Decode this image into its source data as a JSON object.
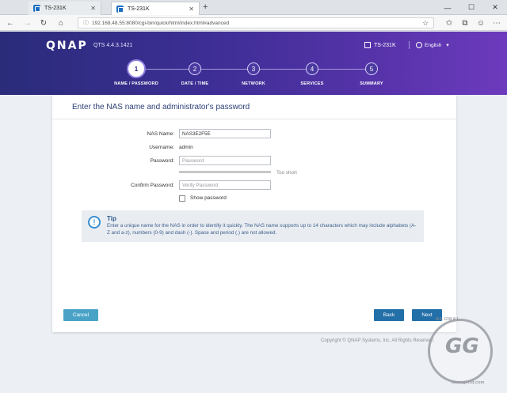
{
  "browser": {
    "tabs": [
      {
        "label": "TS-231K"
      },
      {
        "label": "TS-231K"
      }
    ],
    "new_tab": "+",
    "url": "192.168.48.55:8080/cgi-bin/quick/html/index.html#advanced"
  },
  "header": {
    "logo": "QNAP",
    "version": "QTS 4.4.3.1421",
    "device": "TS-231K",
    "language": "English"
  },
  "steps": [
    {
      "num": "1",
      "label": "NAME / PASSWORD",
      "current": true
    },
    {
      "num": "2",
      "label": "DATE / TIME",
      "current": false
    },
    {
      "num": "3",
      "label": "NETWORK",
      "current": false
    },
    {
      "num": "4",
      "label": "SERVICES",
      "current": false
    },
    {
      "num": "5",
      "label": "SUMMARY",
      "current": false
    }
  ],
  "form": {
    "title": "Enter the NAS name and administrator's password",
    "nas_name_label": "NAS Name:",
    "nas_name_value": "NAS3E2F5E",
    "username_label": "Username:",
    "username_value": "admin",
    "password_label": "Password:",
    "password_placeholder": "Password",
    "strength_text": "Too short",
    "confirm_label": "Confirm Password:",
    "confirm_placeholder": "Verify Password",
    "show_password_label": "Show password"
  },
  "tip": {
    "title": "Tip",
    "text": "Enter a unique name for the NAS in order to identify it quickly. The NAS name supports up to 14 characters which may include alphabets (A-Z and a-z), numbers (0-9) and dash (-). Space and period (.) are not allowed."
  },
  "buttons": {
    "cancel": "Cancel",
    "back": "Back",
    "next": "Next"
  },
  "footer": "Copyright © QNAP Systems, Inc. All Rights Reserved.",
  "watermark": {
    "big": "GG",
    "ring": "GLOBAL",
    "url": "www.gecid.com"
  },
  "colors": {
    "header_start": "#2a2c7a",
    "header_end": "#6c3bbd",
    "primary_button": "#236fa8",
    "cancel_button": "#4aa3c7"
  }
}
